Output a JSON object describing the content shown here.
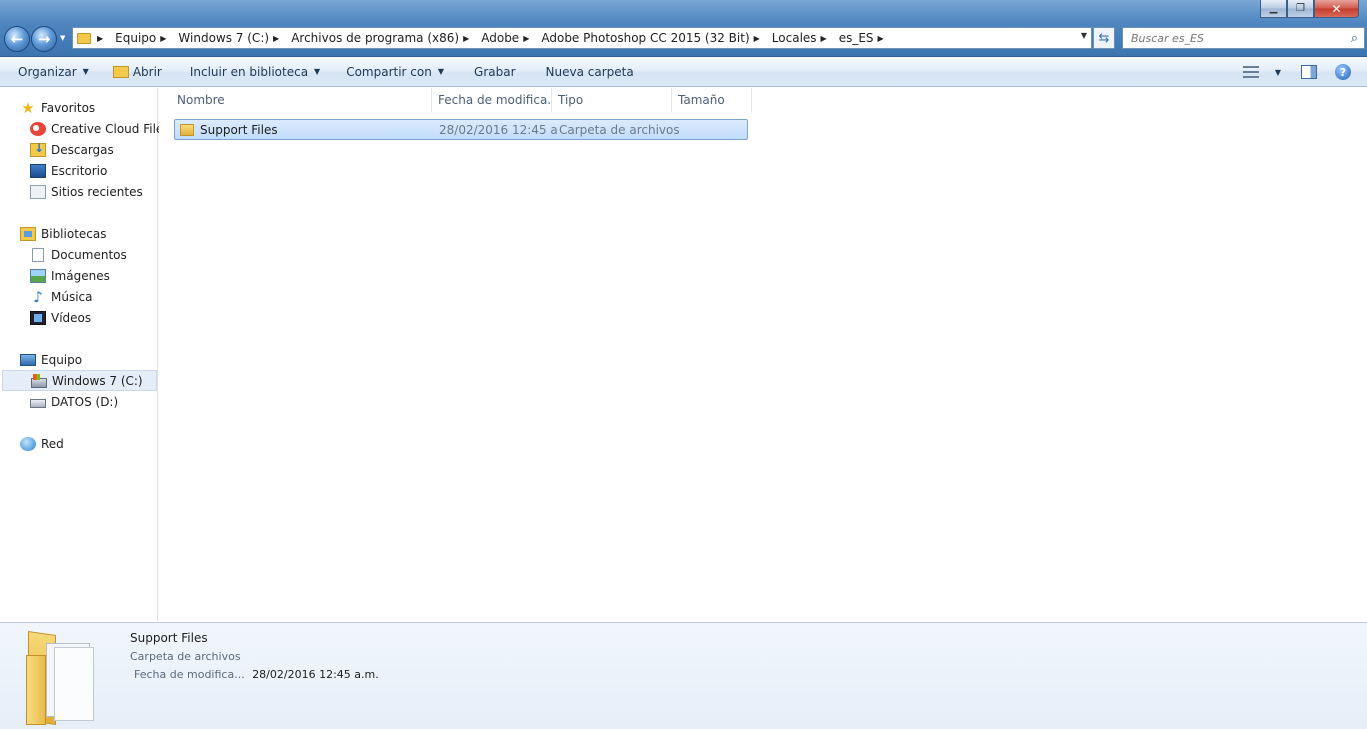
{
  "window": {
    "minimize_glyph": "▁",
    "maximize_glyph": "❐",
    "close_glyph": "✕"
  },
  "address": {
    "crumbs": [
      "Equipo",
      "Windows 7 (C:)",
      "Archivos de programa (x86)",
      "Adobe",
      "Adobe Photoshop CC 2015 (32 Bit)",
      "Locales",
      "es_ES"
    ],
    "dropdown_glyph": "▼"
  },
  "nav_buttons": {
    "back_glyph": "←",
    "forward_glyph": "→",
    "history_glyph": "▼",
    "refresh_glyph": "⇆"
  },
  "search": {
    "placeholder": "Buscar es_ES",
    "icon": "search-icon"
  },
  "toolbar": {
    "organize": "Organizar",
    "open": "Abrir",
    "include_library": "Incluir en biblioteca",
    "share_with": "Compartir con",
    "burn": "Grabar",
    "new_folder": "Nueva carpeta",
    "caret": "▼",
    "help_glyph": "?"
  },
  "navpane": {
    "favorites": {
      "label": "Favoritos",
      "items": [
        "Creative Cloud Files",
        "Descargas",
        "Escritorio",
        "Sitios recientes"
      ]
    },
    "libraries": {
      "label": "Bibliotecas",
      "items": [
        "Documentos",
        "Imágenes",
        "Música",
        "Vídeos"
      ]
    },
    "computer": {
      "label": "Equipo",
      "items": [
        "Windows 7 (C:)",
        "DATOS (D:)"
      ],
      "selected": "Windows 7 (C:)"
    },
    "network": {
      "label": "Red"
    },
    "star_glyph": "★",
    "music_glyph": "♪"
  },
  "columns": {
    "name": "Nombre",
    "date": "Fecha de modifica...",
    "type": "Tipo",
    "size": "Tamaño",
    "sort_glyph": "ˆ"
  },
  "files": [
    {
      "name": "Support Files",
      "date": "28/02/2016 12:45 a...",
      "type": "Carpeta de archivos",
      "size": ""
    }
  ],
  "details": {
    "name": "Support Files",
    "type": "Carpeta de archivos",
    "date_label": "Fecha de modifica...",
    "date_value": "28/02/2016 12:45 a.m."
  }
}
